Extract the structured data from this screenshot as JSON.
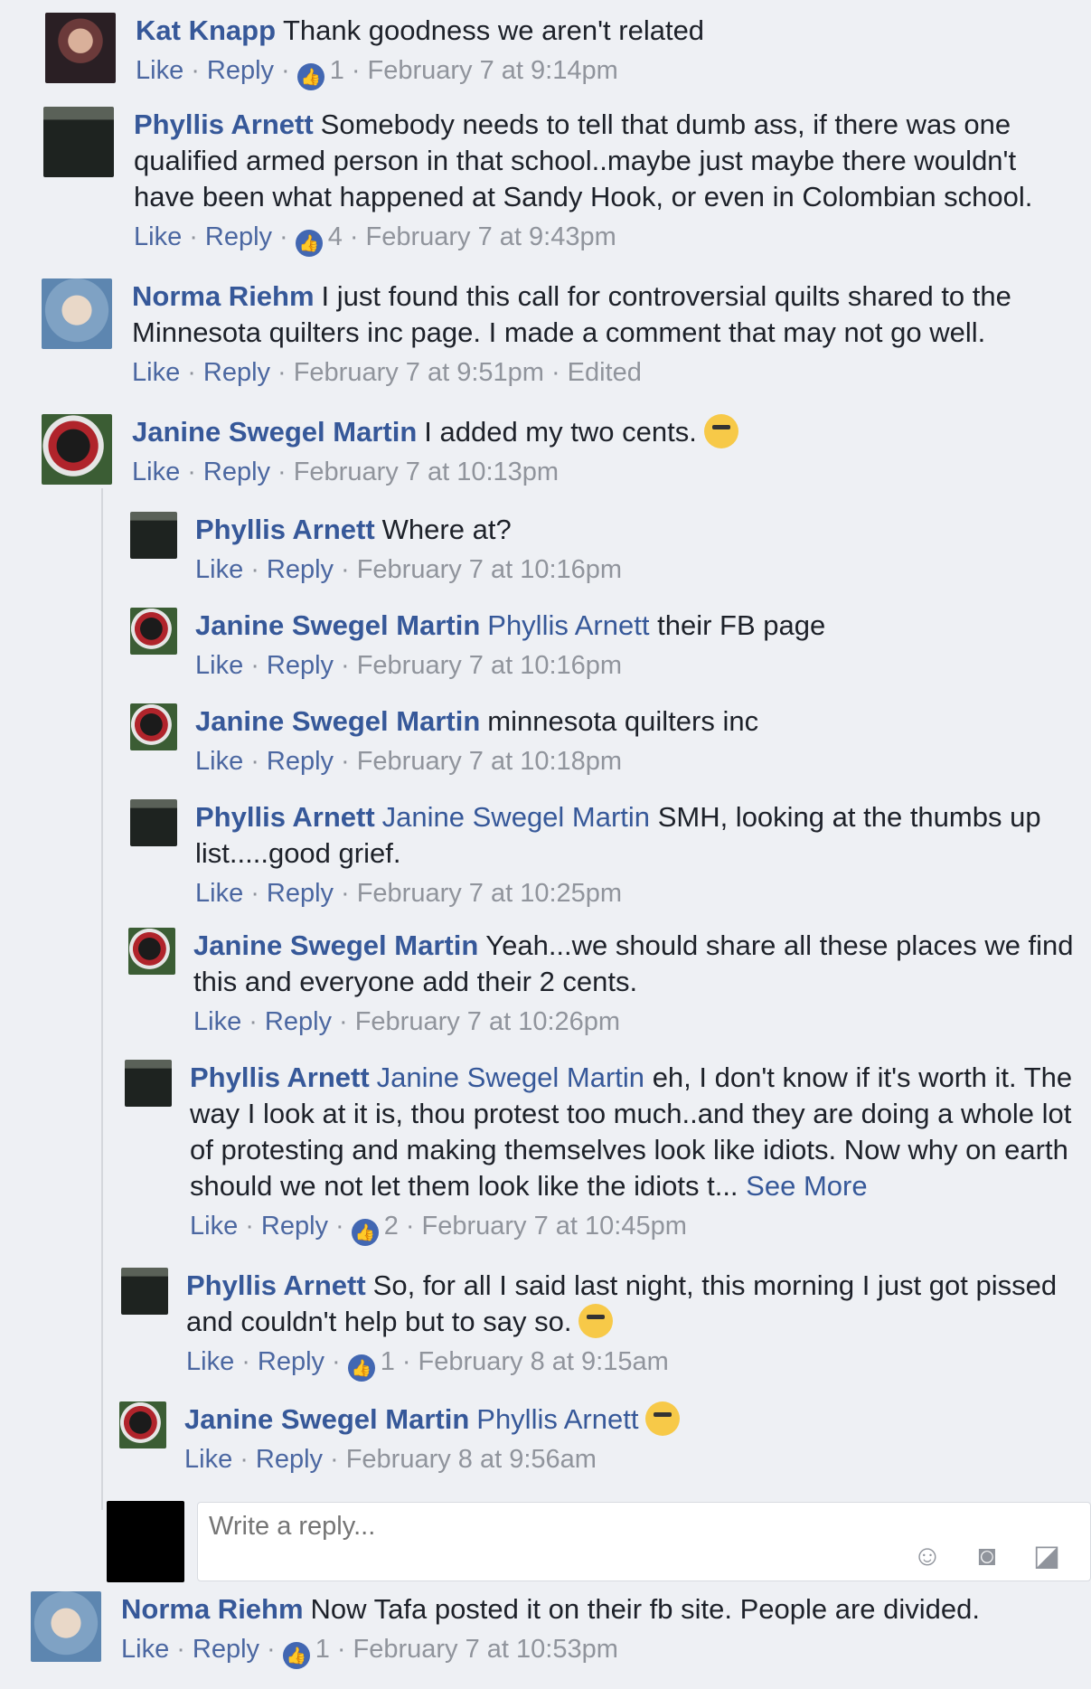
{
  "comments": [
    {
      "author": "Kat Knapp",
      "text": "Thank goodness we aren't related",
      "mention": "",
      "likes": "1",
      "time": "February 7 at 9:14pm",
      "edited": ""
    },
    {
      "author": "Phyllis Arnett",
      "text": "Somebody needs to tell that dumb ass, if there was one qualified armed person in that school..maybe just maybe there wouldn't have been what happened at Sandy Hook, or even in Colombian school.",
      "mention": "",
      "likes": "4",
      "time": "February 7 at 9:43pm",
      "edited": ""
    },
    {
      "author": "Norma Riehm",
      "text": "I just found this call for controversial quilts shared to the Minnesota quilters inc page. I made a comment that may not go well.",
      "mention": "",
      "likes": "",
      "time": "February 7 at 9:51pm",
      "edited": "Edited"
    },
    {
      "author": "Janine Swegel Martin",
      "text": "I added my two cents.",
      "mention": "",
      "likes": "",
      "time": "February 7 at 10:13pm",
      "edited": ""
    }
  ],
  "replies": [
    {
      "author": "Phyllis Arnett",
      "mention": "",
      "text": "Where at?",
      "likes": "",
      "time": "February 7 at 10:16pm"
    },
    {
      "author": "Janine Swegel Martin",
      "mention": "Phyllis Arnett",
      "text": "their FB page",
      "likes": "",
      "time": "February 7 at 10:16pm"
    },
    {
      "author": "Janine Swegel Martin",
      "mention": "",
      "text": "minnesota quilters inc",
      "likes": "",
      "time": "February 7 at 10:18pm"
    },
    {
      "author": "Phyllis Arnett",
      "mention": "Janine Swegel Martin",
      "text": "SMH, looking at the thumbs up list.....good grief.",
      "likes": "",
      "time": "February 7 at 10:25pm"
    },
    {
      "author": "Janine Swegel Martin",
      "mention": "",
      "text": "Yeah...we should share all these places we find this and everyone add their 2 cents.",
      "likes": "",
      "time": "February 7 at 10:26pm"
    },
    {
      "author": "Phyllis Arnett",
      "mention": "Janine Swegel Martin",
      "text": "eh, I don't know if it's worth it. The way I look at it is, thou protest too much..and they are doing a whole lot of protesting and making themselves look like idiots. Now why on earth should we not let them look like the idiots t...",
      "see_more": "See More",
      "likes": "2",
      "time": "February 7 at 10:45pm"
    },
    {
      "author": "Phyllis Arnett",
      "mention": "",
      "text": "So, for all I said last night, this morning I just got pissed and couldn't help but to say so.",
      "likes": "1",
      "time": "February 8 at 9:15am"
    },
    {
      "author": "Janine Swegel Martin",
      "mention": "Phyllis Arnett",
      "text": "",
      "likes": "",
      "time": "February 8 at 9:56am"
    }
  ],
  "reply_box": {
    "placeholder": "Write a reply..."
  },
  "last_comment": {
    "author": "Norma Riehm",
    "text": "Now Tafa posted it on their fb site. People are divided.",
    "likes": "1",
    "time": "February 7 at 10:53pm"
  },
  "labels": {
    "like": "Like",
    "reply": "Reply"
  },
  "icons": {
    "like_badge": "thumbs-up-icon",
    "emoji": "emoji-icon",
    "camera": "camera-icon",
    "sticker": "sticker-icon"
  },
  "colors": {
    "link": "#365899",
    "meta": "#90949c",
    "like_badge": "#4267b2"
  }
}
